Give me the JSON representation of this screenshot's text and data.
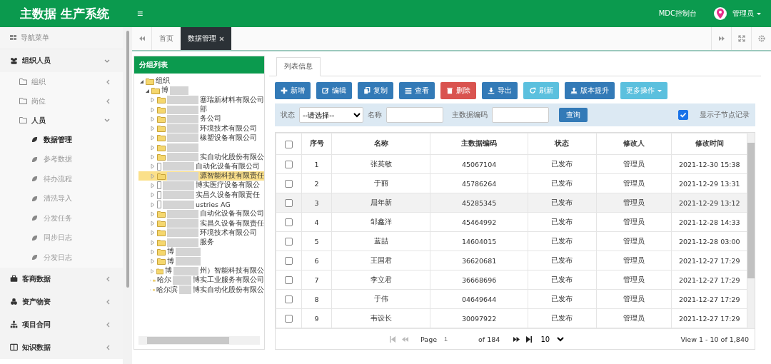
{
  "header": {
    "title": "主数据 生产系统",
    "menu_icon": "≡",
    "console": "MDC控制台",
    "user": "管理员"
  },
  "sidebar": {
    "title": "导航菜单",
    "groups": [
      {
        "label": "组织人员",
        "expanded": true,
        "children": [
          {
            "label": "组织",
            "expanded": false
          },
          {
            "label": "岗位",
            "expanded": false
          },
          {
            "label": "人员",
            "expanded": true,
            "children": [
              {
                "label": "数据管理",
                "selected": true
              },
              {
                "label": "参考数据",
                "selected": false
              },
              {
                "label": "待办流程",
                "selected": false
              },
              {
                "label": "清洗导入",
                "selected": false
              },
              {
                "label": "分发任务",
                "selected": false
              },
              {
                "label": "同步日志",
                "selected": false
              },
              {
                "label": "分发日志",
                "selected": false
              }
            ]
          }
        ]
      },
      {
        "label": "客商数据",
        "expanded": false
      },
      {
        "label": "资产物资",
        "expanded": false
      },
      {
        "label": "项目合同",
        "expanded": false
      },
      {
        "label": "知识数据",
        "expanded": false
      }
    ]
  },
  "tabs": [
    {
      "label": "首页",
      "selected": false,
      "closable": false
    },
    {
      "label": "数据管理",
      "selected": true,
      "closable": true
    }
  ],
  "tree": {
    "title": "分组列表",
    "root": "组织",
    "child": "博",
    "children": [
      {
        "suffix": "塞瑞新材料有限公司",
        "selected": false,
        "kind": "folder"
      },
      {
        "suffix": "部",
        "selected": false,
        "kind": "folder"
      },
      {
        "suffix": "务公司",
        "selected": false,
        "kind": "folder"
      },
      {
        "suffix": "环境技术有限公司",
        "selected": false,
        "kind": "folder"
      },
      {
        "suffix": "橡塑设备有限公司",
        "selected": false,
        "kind": "folder"
      },
      {
        "selected": false,
        "kind": "folder"
      },
      {
        "suffix": "实自动化股份有限公",
        "selected": false,
        "kind": "folder"
      },
      {
        "suffix": "自动化设备有限公司",
        "selected": false,
        "kind": "file"
      },
      {
        "suffix": "源智能科技有限责任",
        "selected": true,
        "kind": "folder"
      },
      {
        "suffix": "博实医疗设备有限公",
        "selected": false,
        "kind": "file"
      },
      {
        "suffix": "实昌久设备有限责任",
        "selected": false,
        "kind": "file"
      },
      {
        "suffix": "ustries AG",
        "selected": false,
        "kind": "file"
      },
      {
        "suffix": "自动化设备有限公司",
        "selected": false,
        "kind": "folder"
      },
      {
        "suffix": "实昌久设备有限责任",
        "selected": false,
        "kind": "folder"
      },
      {
        "suffix": "环境技术有限公司",
        "selected": false,
        "kind": "folder"
      },
      {
        "suffix": "服务",
        "selected": false,
        "kind": "folder"
      },
      {
        "prefix": "博",
        "selected": false,
        "kind": "folder"
      },
      {
        "prefix": "博",
        "selected": false,
        "kind": "folder"
      },
      {
        "prefix": "博",
        "suffix": "州）智能科技有限公",
        "selected": false,
        "kind": "folder"
      },
      {
        "prefix": "哈尔",
        "suffix": "博实工业服务有限公司",
        "selected": false,
        "kind": "folder"
      },
      {
        "prefix": "哈尔滨",
        "suffix": "博实自动化股份有限公",
        "selected": false,
        "kind": "folder"
      }
    ]
  },
  "panel_tab": "列表信息",
  "toolbar": [
    {
      "label": "新增",
      "color": "#337ab7",
      "dropdown": false
    },
    {
      "label": "编辑",
      "color": "#337ab7",
      "dropdown": false
    },
    {
      "label": "复制",
      "color": "#337ab7",
      "dropdown": false
    },
    {
      "label": "查看",
      "color": "#337ab7",
      "dropdown": false
    },
    {
      "label": "删除",
      "color": "#d9534f",
      "dropdown": false
    },
    {
      "label": "导出",
      "color": "#337ab7",
      "dropdown": false
    },
    {
      "label": "刷新",
      "color": "#5bc0de",
      "dropdown": false
    },
    {
      "label": "版本提升",
      "color": "#337ab7",
      "dropdown": false
    },
    {
      "label": "更多操作",
      "color": "#5bc0de",
      "dropdown": true
    }
  ],
  "filter": {
    "status_label": "状态",
    "status_value": "--请选择--",
    "name_label": "名称",
    "code_label": "主数据编码",
    "search": "查询",
    "show_children": "显示子节点记录",
    "show_children_checked": true
  },
  "table": {
    "all_checked": false,
    "columns": [
      "序号",
      "名称",
      "主数据编码",
      "状态",
      "修改人",
      "修改时间"
    ],
    "rows": [
      {
        "cells": [
          "1",
          "张英敏",
          "45067104",
          "已发布",
          "管理员",
          "2021-12-30 15:38"
        ],
        "checked": false,
        "selected": false
      },
      {
        "cells": [
          "2",
          "于丽",
          "45786264",
          "已发布",
          "管理员",
          "2021-12-29 13:31"
        ],
        "checked": false,
        "selected": false
      },
      {
        "cells": [
          "3",
          "屈年新",
          "45285345",
          "已发布",
          "管理员",
          "2021-12-29 13:12"
        ],
        "checked": false,
        "selected": true
      },
      {
        "cells": [
          "4",
          "邹鑫洋",
          "45464992",
          "已发布",
          "管理员",
          "2021-12-28 14:33"
        ],
        "checked": false,
        "selected": false
      },
      {
        "cells": [
          "5",
          "蓝喆",
          "14604015",
          "已发布",
          "管理员",
          "2021-12-28 03:00"
        ],
        "checked": false,
        "selected": false
      },
      {
        "cells": [
          "6",
          "王国君",
          "36620681",
          "已发布",
          "管理员",
          "2021-12-27 17:29"
        ],
        "checked": false,
        "selected": false
      },
      {
        "cells": [
          "7",
          "李立君",
          "36668696",
          "已发布",
          "管理员",
          "2021-12-27 17:29"
        ],
        "checked": false,
        "selected": false
      },
      {
        "cells": [
          "8",
          "于伟",
          "04649644",
          "已发布",
          "管理员",
          "2021-12-27 17:29"
        ],
        "checked": false,
        "selected": false
      },
      {
        "cells": [
          "9",
          "韦设长",
          "30097922",
          "已发布",
          "管理员",
          "2021-12-27 17:29"
        ],
        "checked": false,
        "selected": false
      }
    ]
  },
  "pager": {
    "page_label": "Page",
    "page": "1",
    "of": "of 184",
    "page_size": "10",
    "summary": "View 1 - 10 of 1,840"
  }
}
